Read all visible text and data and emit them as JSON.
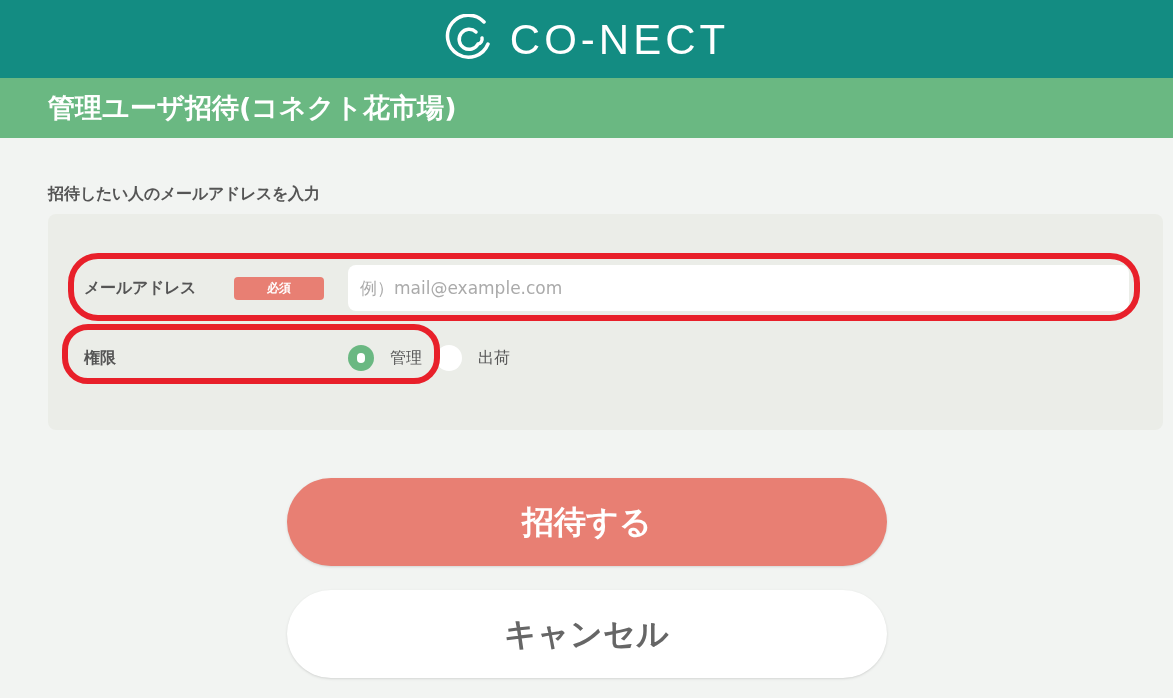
{
  "header": {
    "logo_text": "CO-NECT"
  },
  "page_title": "管理ユーザ招待(コネクト花市場)",
  "section_label": "招待したい人のメールアドレスを入力",
  "email_field": {
    "label": "メールアドレス",
    "badge": "必須",
    "placeholder": "例）mail@example.com"
  },
  "permission": {
    "label": "権限",
    "options": [
      {
        "label": "管理",
        "selected": true
      },
      {
        "label": "出荷",
        "selected": false
      }
    ]
  },
  "buttons": [
    {
      "label": "招待する",
      "kind": "primary"
    },
    {
      "label": "キャンセル",
      "kind": "secondary"
    }
  ]
}
